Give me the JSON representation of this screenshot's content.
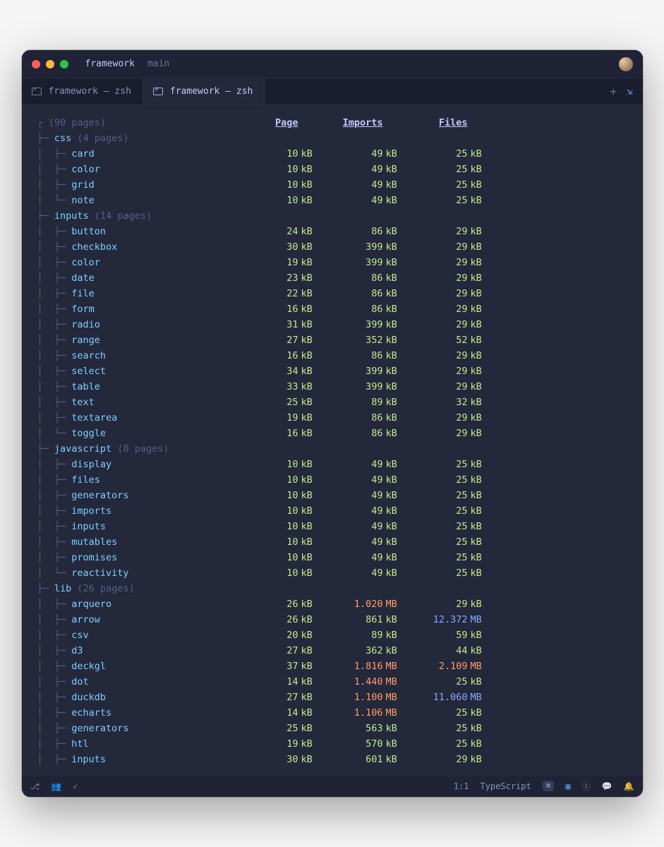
{
  "window": {
    "title": "framework",
    "branch": "main"
  },
  "tabs": [
    {
      "label": "framework — zsh",
      "active": false
    },
    {
      "label": "framework — zsh",
      "active": true
    }
  ],
  "header": {
    "root": "(90 pages)",
    "columns": [
      "Page",
      "Imports",
      "Files"
    ]
  },
  "groups": [
    {
      "name": "css",
      "count": "(4 pages)",
      "rows": [
        {
          "name": "card",
          "page": [
            "10",
            "kB",
            "yg"
          ],
          "imports": [
            "49",
            "kB",
            "yg"
          ],
          "files": [
            "25",
            "kB",
            "yg"
          ]
        },
        {
          "name": "color",
          "page": [
            "10",
            "kB",
            "yg"
          ],
          "imports": [
            "49",
            "kB",
            "yg"
          ],
          "files": [
            "25",
            "kB",
            "yg"
          ]
        },
        {
          "name": "grid",
          "page": [
            "10",
            "kB",
            "yg"
          ],
          "imports": [
            "49",
            "kB",
            "yg"
          ],
          "files": [
            "25",
            "kB",
            "yg"
          ]
        },
        {
          "name": "note",
          "page": [
            "10",
            "kB",
            "yg"
          ],
          "imports": [
            "49",
            "kB",
            "yg"
          ],
          "files": [
            "25",
            "kB",
            "yg"
          ],
          "last": true
        }
      ]
    },
    {
      "name": "inputs",
      "count": "(14 pages)",
      "rows": [
        {
          "name": "button",
          "page": [
            "24",
            "kB",
            "yg"
          ],
          "imports": [
            "86",
            "kB",
            "yg"
          ],
          "files": [
            "29",
            "kB",
            "yg"
          ]
        },
        {
          "name": "checkbox",
          "page": [
            "30",
            "kB",
            "yg"
          ],
          "imports": [
            "399",
            "kB",
            "yg"
          ],
          "files": [
            "29",
            "kB",
            "yg"
          ]
        },
        {
          "name": "color",
          "page": [
            "19",
            "kB",
            "yg"
          ],
          "imports": [
            "399",
            "kB",
            "yg"
          ],
          "files": [
            "29",
            "kB",
            "yg"
          ]
        },
        {
          "name": "date",
          "page": [
            "23",
            "kB",
            "yg"
          ],
          "imports": [
            "86",
            "kB",
            "yg"
          ],
          "files": [
            "29",
            "kB",
            "yg"
          ]
        },
        {
          "name": "file",
          "page": [
            "22",
            "kB",
            "yg"
          ],
          "imports": [
            "86",
            "kB",
            "yg"
          ],
          "files": [
            "29",
            "kB",
            "yg"
          ]
        },
        {
          "name": "form",
          "page": [
            "16",
            "kB",
            "yg"
          ],
          "imports": [
            "86",
            "kB",
            "yg"
          ],
          "files": [
            "29",
            "kB",
            "yg"
          ]
        },
        {
          "name": "radio",
          "page": [
            "31",
            "kB",
            "yg"
          ],
          "imports": [
            "399",
            "kB",
            "yg"
          ],
          "files": [
            "29",
            "kB",
            "yg"
          ]
        },
        {
          "name": "range",
          "page": [
            "27",
            "kB",
            "yg"
          ],
          "imports": [
            "352",
            "kB",
            "yg"
          ],
          "files": [
            "52",
            "kB",
            "yg"
          ]
        },
        {
          "name": "search",
          "page": [
            "16",
            "kB",
            "yg"
          ],
          "imports": [
            "86",
            "kB",
            "yg"
          ],
          "files": [
            "29",
            "kB",
            "yg"
          ]
        },
        {
          "name": "select",
          "page": [
            "34",
            "kB",
            "yg"
          ],
          "imports": [
            "399",
            "kB",
            "yg"
          ],
          "files": [
            "29",
            "kB",
            "yg"
          ]
        },
        {
          "name": "table",
          "page": [
            "33",
            "kB",
            "yg"
          ],
          "imports": [
            "399",
            "kB",
            "yg"
          ],
          "files": [
            "29",
            "kB",
            "yg"
          ]
        },
        {
          "name": "text",
          "page": [
            "25",
            "kB",
            "yg"
          ],
          "imports": [
            "89",
            "kB",
            "yg"
          ],
          "files": [
            "32",
            "kB",
            "yg"
          ]
        },
        {
          "name": "textarea",
          "page": [
            "19",
            "kB",
            "yg"
          ],
          "imports": [
            "86",
            "kB",
            "yg"
          ],
          "files": [
            "29",
            "kB",
            "yg"
          ]
        },
        {
          "name": "toggle",
          "page": [
            "16",
            "kB",
            "yg"
          ],
          "imports": [
            "86",
            "kB",
            "yg"
          ],
          "files": [
            "29",
            "kB",
            "yg"
          ],
          "last": true
        }
      ]
    },
    {
      "name": "javascript",
      "count": "(8 pages)",
      "rows": [
        {
          "name": "display",
          "page": [
            "10",
            "kB",
            "yg"
          ],
          "imports": [
            "49",
            "kB",
            "yg"
          ],
          "files": [
            "25",
            "kB",
            "yg"
          ]
        },
        {
          "name": "files",
          "page": [
            "10",
            "kB",
            "yg"
          ],
          "imports": [
            "49",
            "kB",
            "yg"
          ],
          "files": [
            "25",
            "kB",
            "yg"
          ]
        },
        {
          "name": "generators",
          "page": [
            "10",
            "kB",
            "yg"
          ],
          "imports": [
            "49",
            "kB",
            "yg"
          ],
          "files": [
            "25",
            "kB",
            "yg"
          ]
        },
        {
          "name": "imports",
          "page": [
            "10",
            "kB",
            "yg"
          ],
          "imports": [
            "49",
            "kB",
            "yg"
          ],
          "files": [
            "25",
            "kB",
            "yg"
          ]
        },
        {
          "name": "inputs",
          "page": [
            "10",
            "kB",
            "yg"
          ],
          "imports": [
            "49",
            "kB",
            "yg"
          ],
          "files": [
            "25",
            "kB",
            "yg"
          ]
        },
        {
          "name": "mutables",
          "page": [
            "10",
            "kB",
            "yg"
          ],
          "imports": [
            "49",
            "kB",
            "yg"
          ],
          "files": [
            "25",
            "kB",
            "yg"
          ]
        },
        {
          "name": "promises",
          "page": [
            "10",
            "kB",
            "yg"
          ],
          "imports": [
            "49",
            "kB",
            "yg"
          ],
          "files": [
            "25",
            "kB",
            "yg"
          ]
        },
        {
          "name": "reactivity",
          "page": [
            "10",
            "kB",
            "yg"
          ],
          "imports": [
            "49",
            "kB",
            "yg"
          ],
          "files": [
            "25",
            "kB",
            "yg"
          ],
          "last": true
        }
      ]
    },
    {
      "name": "lib",
      "count": "(26 pages)",
      "rows": [
        {
          "name": "arquero",
          "page": [
            "26",
            "kB",
            "yg"
          ],
          "imports": [
            "1.020",
            "MB",
            "orange"
          ],
          "files": [
            "29",
            "kB",
            "yg"
          ]
        },
        {
          "name": "arrow",
          "page": [
            "26",
            "kB",
            "yg"
          ],
          "imports": [
            "861",
            "kB",
            "yg"
          ],
          "files": [
            "12.372",
            "MB",
            "blue"
          ]
        },
        {
          "name": "csv",
          "page": [
            "20",
            "kB",
            "yg"
          ],
          "imports": [
            "89",
            "kB",
            "yg"
          ],
          "files": [
            "59",
            "kB",
            "yg"
          ]
        },
        {
          "name": "d3",
          "page": [
            "27",
            "kB",
            "yg"
          ],
          "imports": [
            "362",
            "kB",
            "yg"
          ],
          "files": [
            "44",
            "kB",
            "yg"
          ]
        },
        {
          "name": "deckgl",
          "page": [
            "37",
            "kB",
            "yg"
          ],
          "imports": [
            "1.816",
            "MB",
            "orange"
          ],
          "files": [
            "2.109",
            "MB",
            "orange"
          ]
        },
        {
          "name": "dot",
          "page": [
            "14",
            "kB",
            "yg"
          ],
          "imports": [
            "1.440",
            "MB",
            "orange"
          ],
          "files": [
            "25",
            "kB",
            "yg"
          ]
        },
        {
          "name": "duckdb",
          "page": [
            "27",
            "kB",
            "yg"
          ],
          "imports": [
            "1.100",
            "MB",
            "orange"
          ],
          "files": [
            "11.060",
            "MB",
            "blue"
          ]
        },
        {
          "name": "echarts",
          "page": [
            "14",
            "kB",
            "yg"
          ],
          "imports": [
            "1.106",
            "MB",
            "orange"
          ],
          "files": [
            "25",
            "kB",
            "yg"
          ]
        },
        {
          "name": "generators",
          "page": [
            "25",
            "kB",
            "yg"
          ],
          "imports": [
            "563",
            "kB",
            "yg"
          ],
          "files": [
            "25",
            "kB",
            "yg"
          ]
        },
        {
          "name": "htl",
          "page": [
            "19",
            "kB",
            "yg"
          ],
          "imports": [
            "570",
            "kB",
            "yg"
          ],
          "files": [
            "25",
            "kB",
            "yg"
          ]
        },
        {
          "name": "inputs",
          "page": [
            "30",
            "kB",
            "yg"
          ],
          "imports": [
            "601",
            "kB",
            "yg"
          ],
          "files": [
            "29",
            "kB",
            "yg"
          ]
        }
      ]
    }
  ],
  "statusbar": {
    "cursor": "1:1",
    "lang": "TypeScript"
  }
}
